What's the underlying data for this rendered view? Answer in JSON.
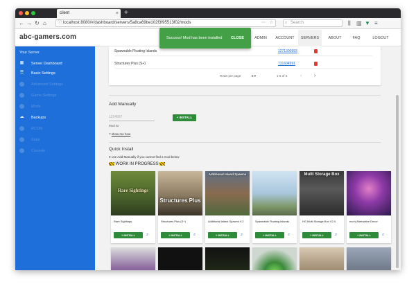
{
  "browser": {
    "tab_title": "client",
    "tab_close": "×",
    "new_tab": "+",
    "url": "localhost:8080/#/dashboard/servers/5a8ca69be102f3f95513f02/mods",
    "search_placeholder": "Search",
    "icons": [
      "back-icon",
      "forward-icon",
      "reload-icon",
      "home-icon",
      "info-icon",
      "bookmark-icon",
      "star-icon",
      "library-icon",
      "sidebar-icon",
      "extension-icon",
      "menu-icon"
    ]
  },
  "site": {
    "logo": "abc-gamers.com",
    "menu": [
      {
        "label": "ADMIN"
      },
      {
        "label": "ACCOUNT"
      },
      {
        "label": "SERVERS"
      },
      {
        "label": "ABOUT"
      },
      {
        "label": "FAQ"
      },
      {
        "label": "LOGOUT"
      }
    ],
    "active_menu": "SERVERS"
  },
  "toast": {
    "message": "Success! Mod has been installed",
    "action": "CLOSE"
  },
  "sidebar": {
    "title": "Your Server",
    "items": [
      {
        "label": "Server Dashboard",
        "icon": "dashboard-icon",
        "enabled": true
      },
      {
        "label": "Basic Settings",
        "icon": "settings-icon",
        "enabled": true
      },
      {
        "label": "Advanced Settings",
        "icon": "advanced-settings-icon",
        "enabled": false
      },
      {
        "label": "Game Settings",
        "icon": "game-settings-icon",
        "enabled": false
      },
      {
        "label": "Mods",
        "icon": "mods-icon",
        "enabled": false
      },
      {
        "label": "Backups",
        "icon": "cloud-icon",
        "enabled": true
      },
      {
        "label": "RCON",
        "icon": "rcon-icon",
        "enabled": false
      },
      {
        "label": "Stats",
        "icon": "stats-icon",
        "enabled": false
      },
      {
        "label": "Console",
        "icon": "console-icon",
        "enabled": false
      }
    ]
  },
  "installed": {
    "rows": [
      {
        "name": "Spawnable Floating Islands",
        "id": "1271300993"
      },
      {
        "name": "Structures Plus (S+)",
        "id": "731604991"
      }
    ],
    "rows_per_page_label": "Rows per page:",
    "rows_per_page": "5",
    "range": "1-5 of 5"
  },
  "manual": {
    "heading": "Add Manually",
    "input_placeholder": "1234567",
    "input_label": "Mod ID",
    "button": "+ INSTALL",
    "help_link": "show me how"
  },
  "quick": {
    "heading": "Quick Install",
    "hint": "use Add Manually if you cannot find a mod below",
    "wip": "WORK IN PROGRESS",
    "install_label": "+ INSTALL",
    "mods": [
      {
        "name": "Rare Sightings",
        "image_text": "Rare Sightings"
      },
      {
        "name": "Structures Plus (S+)",
        "image_text": "Structures Plus"
      },
      {
        "name": "Additional Island Spawns V.2",
        "image_text": "Additional Island Spawns"
      },
      {
        "name": "Spawnable Floating Islands",
        "image_text": ""
      },
      {
        "name": "HG Multi Storage Box V2.4",
        "image_text": "Multi Storage Box"
      },
      {
        "name": "eco's Alternative Decor",
        "image_text": ""
      }
    ]
  },
  "colors": {
    "sidebar": "#1e6fd9",
    "accent_green": "#2e8b3a",
    "toast": "#43a047",
    "link": "#1e6fd9",
    "delete": "#e53935"
  }
}
